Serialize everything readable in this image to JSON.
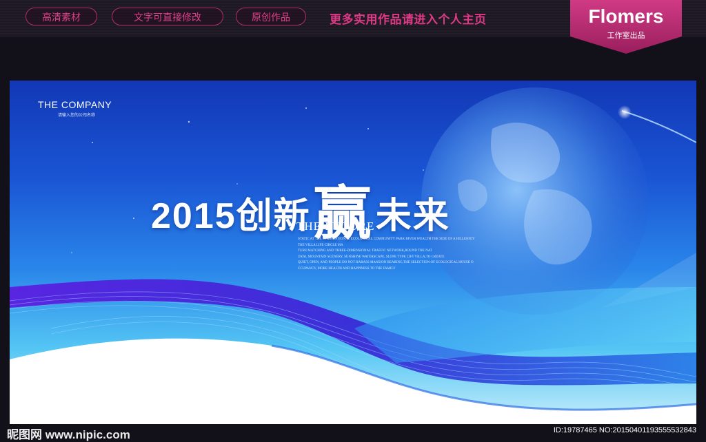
{
  "topbar": {
    "pills": [
      "高清素材",
      "文字可直接修改",
      "原创作品"
    ],
    "promo": "更多实用作品请进入个人主页"
  },
  "brand": {
    "name": "Flomers",
    "subtitle": "工作室出品"
  },
  "poster": {
    "company": "THE COMPANY",
    "company_sub": "请输入您的公司名称",
    "headline_pre": "2015创新",
    "headline_big": "赢",
    "headline_post": "未来",
    "future": "THE FUTURE",
    "blurb": [
      "STATIC AT THE INTERNATIONAL ECOLOGICAL COMMUNITY PARK RIVER WEALTH THE SIDE OF A HILLENJOY",
      "THE VILLA LIFE CIRCLE MA",
      "TURE MATCHING AND THREE-DIMENSIONAL TRAFFIC NETWORK,ROUND THE NAT",
      "URAL MOUNTAIN SCENERY, SUNSHINE WATERSCAPE, SLOPE TYPE LIFT VILLA,TO CREATE",
      "QUIET, OPEN, AND PEOPLE DO NOT HARASS MANSION BEARING,THE SELECTION OF ECOLOGICAL HOUSE O",
      "CCUPANCY, MORE HEALTH AND HAPPINESS TO THE FAMILY"
    ]
  },
  "footer": {
    "watermark": "昵图网 www.nipic.com",
    "image_id": "ID:19787465 NO:20150401193555532843"
  },
  "colors": {
    "accent_pink": "#e03a86",
    "poster_blue": "#1a55d4",
    "wave_purple": "#4a1fd0"
  }
}
